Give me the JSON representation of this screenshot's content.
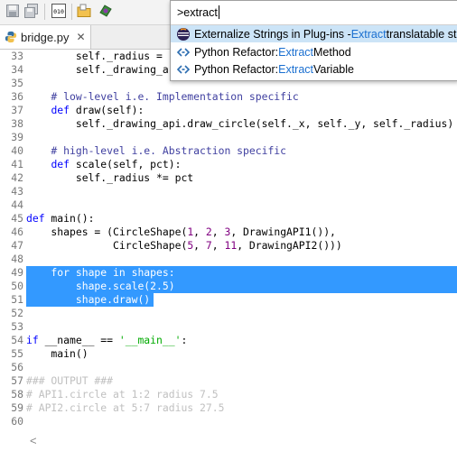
{
  "toolbar": {
    "icons": [
      "save-icon",
      "save-all-icon",
      "binary-icon",
      "folder-icon",
      "perspective-icon"
    ]
  },
  "tab": {
    "icon": "python-file-icon",
    "label": "bridge.py",
    "close": "✕"
  },
  "quick_access": {
    "query": ">extract",
    "items": [
      {
        "icon": "eclipse-icon",
        "pre": "Externalize Strings in Plug-ins - ",
        "match": "Extract",
        "post": " translatable strings",
        "selected": true
      },
      {
        "icon": "refactor-icon",
        "pre": "Python Refactor: ",
        "match": "Extract",
        "post": " Method",
        "selected": false
      },
      {
        "icon": "refactor-icon",
        "pre": "Python Refactor: ",
        "match": "Extract",
        "post": " Variable",
        "selected": false
      }
    ]
  },
  "editor": {
    "selected_lines": [
      49,
      50,
      51
    ],
    "lines": [
      {
        "n": "33",
        "text": "        self._radius = "
      },
      {
        "n": "34",
        "text": "        self._drawing_a"
      },
      {
        "n": "35",
        "text": ""
      },
      {
        "n": "36",
        "text": "    # low-level i.e. Implementation specific"
      },
      {
        "n": "37",
        "text": "    def draw(self):"
      },
      {
        "n": "38",
        "text": "        self._drawing_api.draw_circle(self._x, self._y, self._radius)"
      },
      {
        "n": "39",
        "text": ""
      },
      {
        "n": "40",
        "text": "    # high-level i.e. Abstraction specific"
      },
      {
        "n": "41",
        "text": "    def scale(self, pct):"
      },
      {
        "n": "42",
        "text": "        self._radius *= pct"
      },
      {
        "n": "43",
        "text": ""
      },
      {
        "n": "44",
        "text": ""
      },
      {
        "n": "45",
        "text": "def main():"
      },
      {
        "n": "46",
        "text": "    shapes = (CircleShape(1, 2, 3, DrawingAPI1()),"
      },
      {
        "n": "47",
        "text": "              CircleShape(5, 7, 11, DrawingAPI2()))"
      },
      {
        "n": "48",
        "text": ""
      },
      {
        "n": "49",
        "text": "    for shape in shapes:"
      },
      {
        "n": "50",
        "text": "        shape.scale(2.5)"
      },
      {
        "n": "51",
        "text": "        shape.draw()"
      },
      {
        "n": "52",
        "text": ""
      },
      {
        "n": "53",
        "text": ""
      },
      {
        "n": "54",
        "text": "if __name__ == '__main__':"
      },
      {
        "n": "55",
        "text": "    main()"
      },
      {
        "n": "56",
        "text": ""
      },
      {
        "n": "57",
        "text": "### OUTPUT ###"
      },
      {
        "n": "58",
        "text": "# API1.circle at 1:2 radius 7.5"
      },
      {
        "n": "59",
        "text": "# API2.circle at 5:7 radius 27.5"
      },
      {
        "n": "60",
        "text": ""
      }
    ]
  },
  "scrollbar": {
    "left_arrow": "<"
  },
  "colors": {
    "selection": "#3399ff",
    "keyword": "#0000ff",
    "number": "#800080",
    "string": "#00aa00",
    "comment": "#c0c0c0"
  }
}
